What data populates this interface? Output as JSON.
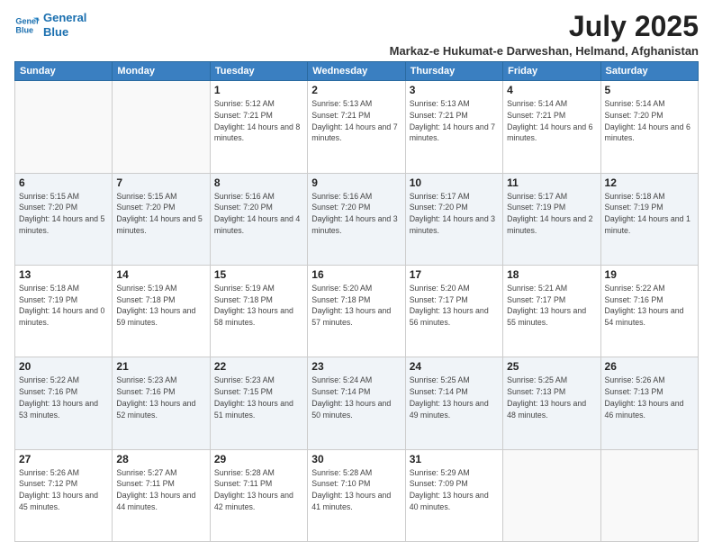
{
  "header": {
    "logo_line1": "General",
    "logo_line2": "Blue",
    "month": "July 2025",
    "location": "Markaz-e Hukumat-e Darweshan, Helmand, Afghanistan"
  },
  "days_of_week": [
    "Sunday",
    "Monday",
    "Tuesday",
    "Wednesday",
    "Thursday",
    "Friday",
    "Saturday"
  ],
  "weeks": [
    [
      {
        "day": "",
        "info": ""
      },
      {
        "day": "",
        "info": ""
      },
      {
        "day": "1",
        "info": "Sunrise: 5:12 AM\nSunset: 7:21 PM\nDaylight: 14 hours and 8 minutes."
      },
      {
        "day": "2",
        "info": "Sunrise: 5:13 AM\nSunset: 7:21 PM\nDaylight: 14 hours and 7 minutes."
      },
      {
        "day": "3",
        "info": "Sunrise: 5:13 AM\nSunset: 7:21 PM\nDaylight: 14 hours and 7 minutes."
      },
      {
        "day": "4",
        "info": "Sunrise: 5:14 AM\nSunset: 7:21 PM\nDaylight: 14 hours and 6 minutes."
      },
      {
        "day": "5",
        "info": "Sunrise: 5:14 AM\nSunset: 7:20 PM\nDaylight: 14 hours and 6 minutes."
      }
    ],
    [
      {
        "day": "6",
        "info": "Sunrise: 5:15 AM\nSunset: 7:20 PM\nDaylight: 14 hours and 5 minutes."
      },
      {
        "day": "7",
        "info": "Sunrise: 5:15 AM\nSunset: 7:20 PM\nDaylight: 14 hours and 5 minutes."
      },
      {
        "day": "8",
        "info": "Sunrise: 5:16 AM\nSunset: 7:20 PM\nDaylight: 14 hours and 4 minutes."
      },
      {
        "day": "9",
        "info": "Sunrise: 5:16 AM\nSunset: 7:20 PM\nDaylight: 14 hours and 3 minutes."
      },
      {
        "day": "10",
        "info": "Sunrise: 5:17 AM\nSunset: 7:20 PM\nDaylight: 14 hours and 3 minutes."
      },
      {
        "day": "11",
        "info": "Sunrise: 5:17 AM\nSunset: 7:19 PM\nDaylight: 14 hours and 2 minutes."
      },
      {
        "day": "12",
        "info": "Sunrise: 5:18 AM\nSunset: 7:19 PM\nDaylight: 14 hours and 1 minute."
      }
    ],
    [
      {
        "day": "13",
        "info": "Sunrise: 5:18 AM\nSunset: 7:19 PM\nDaylight: 14 hours and 0 minutes."
      },
      {
        "day": "14",
        "info": "Sunrise: 5:19 AM\nSunset: 7:18 PM\nDaylight: 13 hours and 59 minutes."
      },
      {
        "day": "15",
        "info": "Sunrise: 5:19 AM\nSunset: 7:18 PM\nDaylight: 13 hours and 58 minutes."
      },
      {
        "day": "16",
        "info": "Sunrise: 5:20 AM\nSunset: 7:18 PM\nDaylight: 13 hours and 57 minutes."
      },
      {
        "day": "17",
        "info": "Sunrise: 5:20 AM\nSunset: 7:17 PM\nDaylight: 13 hours and 56 minutes."
      },
      {
        "day": "18",
        "info": "Sunrise: 5:21 AM\nSunset: 7:17 PM\nDaylight: 13 hours and 55 minutes."
      },
      {
        "day": "19",
        "info": "Sunrise: 5:22 AM\nSunset: 7:16 PM\nDaylight: 13 hours and 54 minutes."
      }
    ],
    [
      {
        "day": "20",
        "info": "Sunrise: 5:22 AM\nSunset: 7:16 PM\nDaylight: 13 hours and 53 minutes."
      },
      {
        "day": "21",
        "info": "Sunrise: 5:23 AM\nSunset: 7:16 PM\nDaylight: 13 hours and 52 minutes."
      },
      {
        "day": "22",
        "info": "Sunrise: 5:23 AM\nSunset: 7:15 PM\nDaylight: 13 hours and 51 minutes."
      },
      {
        "day": "23",
        "info": "Sunrise: 5:24 AM\nSunset: 7:14 PM\nDaylight: 13 hours and 50 minutes."
      },
      {
        "day": "24",
        "info": "Sunrise: 5:25 AM\nSunset: 7:14 PM\nDaylight: 13 hours and 49 minutes."
      },
      {
        "day": "25",
        "info": "Sunrise: 5:25 AM\nSunset: 7:13 PM\nDaylight: 13 hours and 48 minutes."
      },
      {
        "day": "26",
        "info": "Sunrise: 5:26 AM\nSunset: 7:13 PM\nDaylight: 13 hours and 46 minutes."
      }
    ],
    [
      {
        "day": "27",
        "info": "Sunrise: 5:26 AM\nSunset: 7:12 PM\nDaylight: 13 hours and 45 minutes."
      },
      {
        "day": "28",
        "info": "Sunrise: 5:27 AM\nSunset: 7:11 PM\nDaylight: 13 hours and 44 minutes."
      },
      {
        "day": "29",
        "info": "Sunrise: 5:28 AM\nSunset: 7:11 PM\nDaylight: 13 hours and 42 minutes."
      },
      {
        "day": "30",
        "info": "Sunrise: 5:28 AM\nSunset: 7:10 PM\nDaylight: 13 hours and 41 minutes."
      },
      {
        "day": "31",
        "info": "Sunrise: 5:29 AM\nSunset: 7:09 PM\nDaylight: 13 hours and 40 minutes."
      },
      {
        "day": "",
        "info": ""
      },
      {
        "day": "",
        "info": ""
      }
    ]
  ]
}
